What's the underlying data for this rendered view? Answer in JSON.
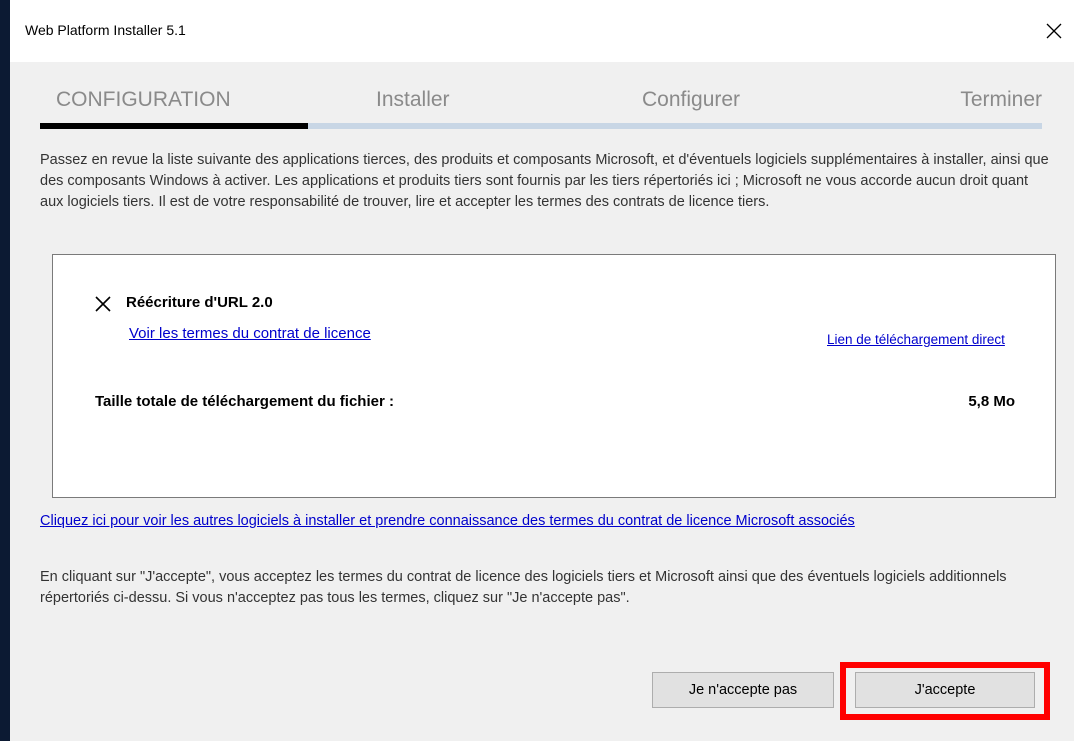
{
  "window": {
    "title": "Web Platform Installer 5.1"
  },
  "steps": [
    {
      "label": "CONFIGURATION",
      "active": true
    },
    {
      "label": "Installer",
      "active": false
    },
    {
      "label": "Configurer",
      "active": false
    },
    {
      "label": "Terminer",
      "active": false
    }
  ],
  "progress": {
    "current_step": 1,
    "total_steps": 4
  },
  "intro_text": "Passez en revue la liste suivante des applications tierces, des produits et composants Microsoft, et d'éventuels logiciels supplémentaires à installer, ainsi que des composants Windows à activer. Les applications et produits tiers sont fournis par les tiers répertoriés ici ; Microsoft ne vous accorde aucun droit quant aux logiciels tiers. Il est de votre responsabilité de trouver, lire et accepter les termes des contrats de licence tiers.",
  "item": {
    "name": "Réécriture d'URL 2.0",
    "license_link": "Voir les termes du contrat de licence",
    "direct_link": "Lien de téléchargement direct"
  },
  "total_size": {
    "label": "Taille totale de téléchargement du fichier :",
    "value": "5,8 Mo"
  },
  "more_link": "Cliquez ici pour voir les autres logiciels à installer et prendre connaissance des termes du contrat de licence Microsoft associés",
  "accept_text": "En cliquant sur \"J'accepte\", vous acceptez les termes du contrat de licence des logiciels tiers et Microsoft ainsi que des éventuels logiciels additionnels répertoriés ci-dessu. Si vous n'acceptez pas tous les termes, cliquez sur \"Je n'accepte pas\".",
  "buttons": {
    "decline": "Je n'accepte pas",
    "accept": "J'accepte"
  },
  "icons": {
    "close": "close-icon",
    "item_remove": "x-icon"
  },
  "colors": {
    "link": "#0000cc",
    "highlight": "#ff0000",
    "progress_active": "#000000",
    "progress_inactive": "#c8d6e5"
  }
}
